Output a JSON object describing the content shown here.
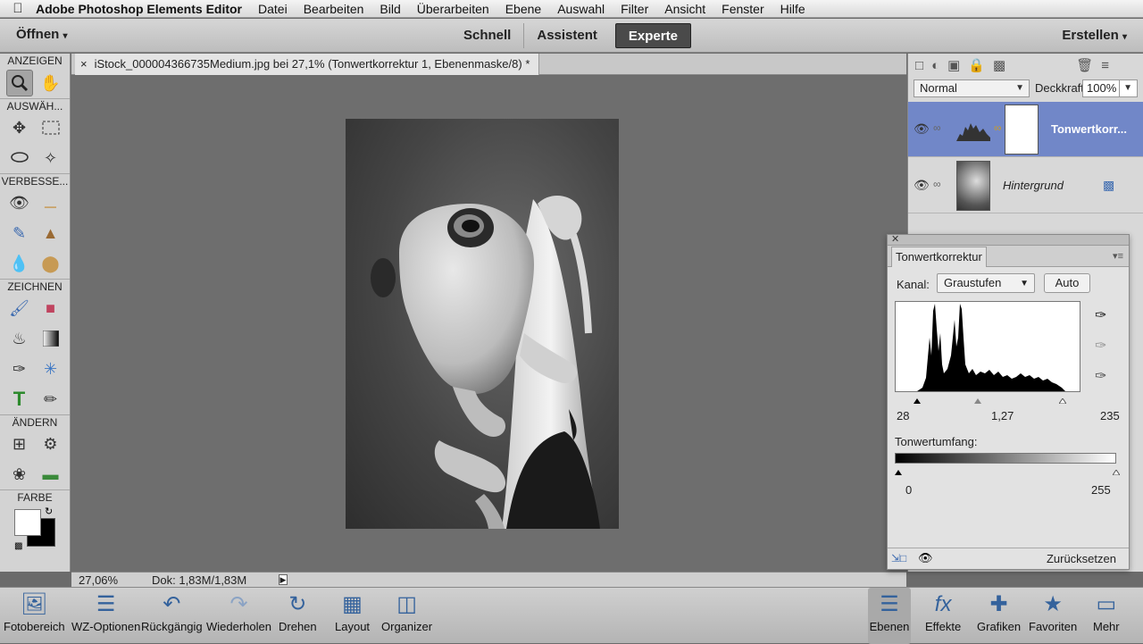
{
  "menubar": {
    "app": "Adobe Photoshop Elements Editor",
    "items": [
      "Datei",
      "Bearbeiten",
      "Bild",
      "Überarbeiten",
      "Ebene",
      "Auswahl",
      "Filter",
      "Ansicht",
      "Fenster",
      "Hilfe"
    ]
  },
  "modebar": {
    "open_label": "Öffnen",
    "modes": [
      "Schnell",
      "Assistent",
      "Experte"
    ],
    "active_mode": "Experte",
    "create_label": "Erstellen"
  },
  "toolbox": {
    "sections": [
      "ANZEIGEN",
      "AUSWÄH...",
      "VERBESSE...",
      "ZEICHNEN",
      "ÄNDERN",
      "FARBE"
    ]
  },
  "document": {
    "tab_title": "iStock_000004366735Medium.jpg bei 27,1% (Tonwertkorrektur 1, Ebenenmaske/8) *",
    "close": "×"
  },
  "status": {
    "zoom": "27,06%",
    "doc_size": "Dok: 1,83M/1,83M"
  },
  "layers": {
    "blend_mode": "Normal",
    "opacity_label": "Deckkraft:",
    "opacity": "100%",
    "items": [
      {
        "name": "Tonwertkorr...",
        "selected": true
      },
      {
        "name": "Hintergrund",
        "selected": false
      }
    ]
  },
  "levels": {
    "tab": "Tonwertkorrektur",
    "channel_label": "Kanal:",
    "channel": "Graustufen",
    "auto_label": "Auto",
    "input_black": "28",
    "input_gamma": "1,27",
    "input_white": "235",
    "input_black_value": 28,
    "input_gamma_position": 0.44,
    "input_white_value": 235,
    "output_label": "Tonwertumfang:",
    "output_black": "0",
    "output_white": "255",
    "reset_label": "Zurücksetzen"
  },
  "taskbar": {
    "items": [
      "Fotobereich",
      "WZ-Optionen",
      "Rückgängig",
      "Wiederholen",
      "Drehen",
      "Layout",
      "Organizer"
    ],
    "right_items": [
      "Ebenen",
      "Effekte",
      "Grafiken",
      "Favoriten",
      "Mehr"
    ]
  },
  "colors": {
    "accent": "#34629c",
    "selected_layer": "#7187c8"
  }
}
